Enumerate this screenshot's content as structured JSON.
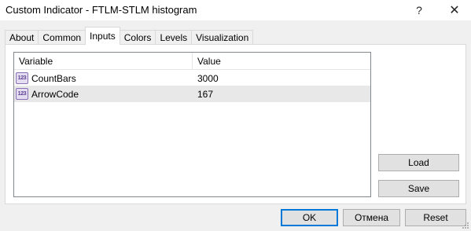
{
  "window": {
    "title": "Custom Indicator - FTLM-STLM histogram",
    "help_label": "?",
    "close_label": "✕"
  },
  "tabs": [
    {
      "label": "About"
    },
    {
      "label": "Common"
    },
    {
      "label": "Inputs"
    },
    {
      "label": "Colors"
    },
    {
      "label": "Levels"
    },
    {
      "label": "Visualization"
    }
  ],
  "active_tab": "Inputs",
  "grid": {
    "headers": {
      "variable": "Variable",
      "value": "Value"
    },
    "rows": [
      {
        "icon": "integer-param-icon",
        "variable": "CountBars",
        "value": "3000"
      },
      {
        "icon": "integer-param-icon",
        "variable": "ArrowCode",
        "value": "167"
      }
    ],
    "icon_text": "123"
  },
  "buttons": {
    "load": "Load",
    "save": "Save",
    "ok": "OK",
    "cancel": "Отмена",
    "reset": "Reset"
  },
  "colors": {
    "ok_border": "#0078d7",
    "selected_row": "#e8e8e8",
    "icon_accent": "#8a6fb8"
  }
}
